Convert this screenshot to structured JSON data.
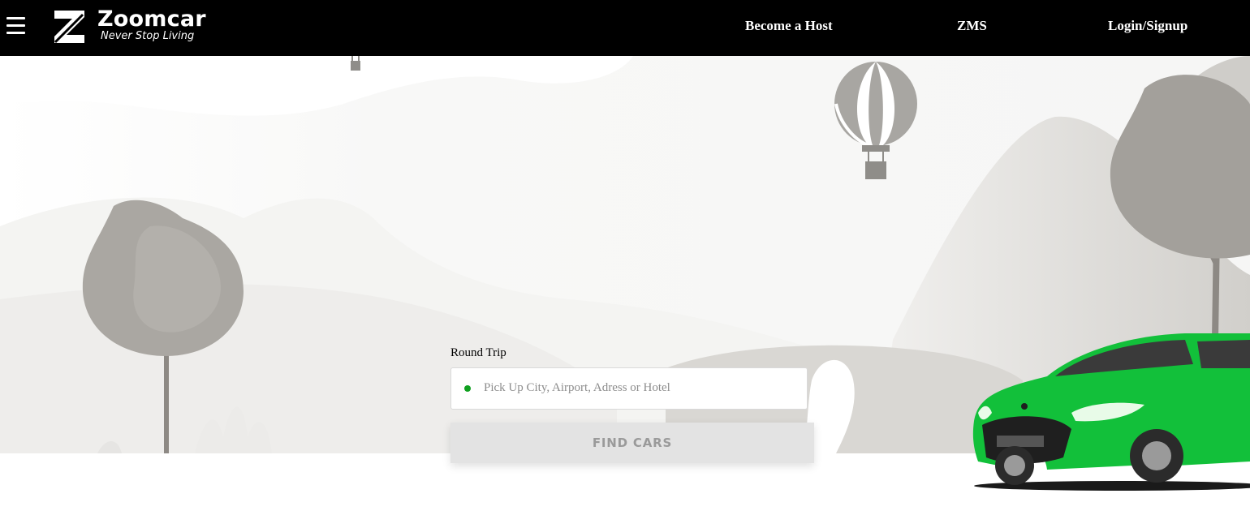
{
  "header": {
    "brand_name": "Zoomcar",
    "tagline": "Never Stop Living",
    "nav": {
      "become_host": "Become a Host",
      "zms": "ZMS",
      "login": "Login/Signup"
    }
  },
  "search": {
    "trip_type": "Round Trip",
    "pickup_placeholder": "Pick Up City, Airport, Adress or Hotel",
    "pickup_value": "",
    "find_button": "FIND CARS"
  },
  "colors": {
    "navbar": "#000000",
    "accent_green": "#10a020",
    "car_green": "#12c03a",
    "button_disabled": "#e3e3e3"
  },
  "icons": {
    "menu": "hamburger-menu-icon",
    "logo": "zoomcar-z-logo",
    "pickup": "green-dot-icon"
  }
}
